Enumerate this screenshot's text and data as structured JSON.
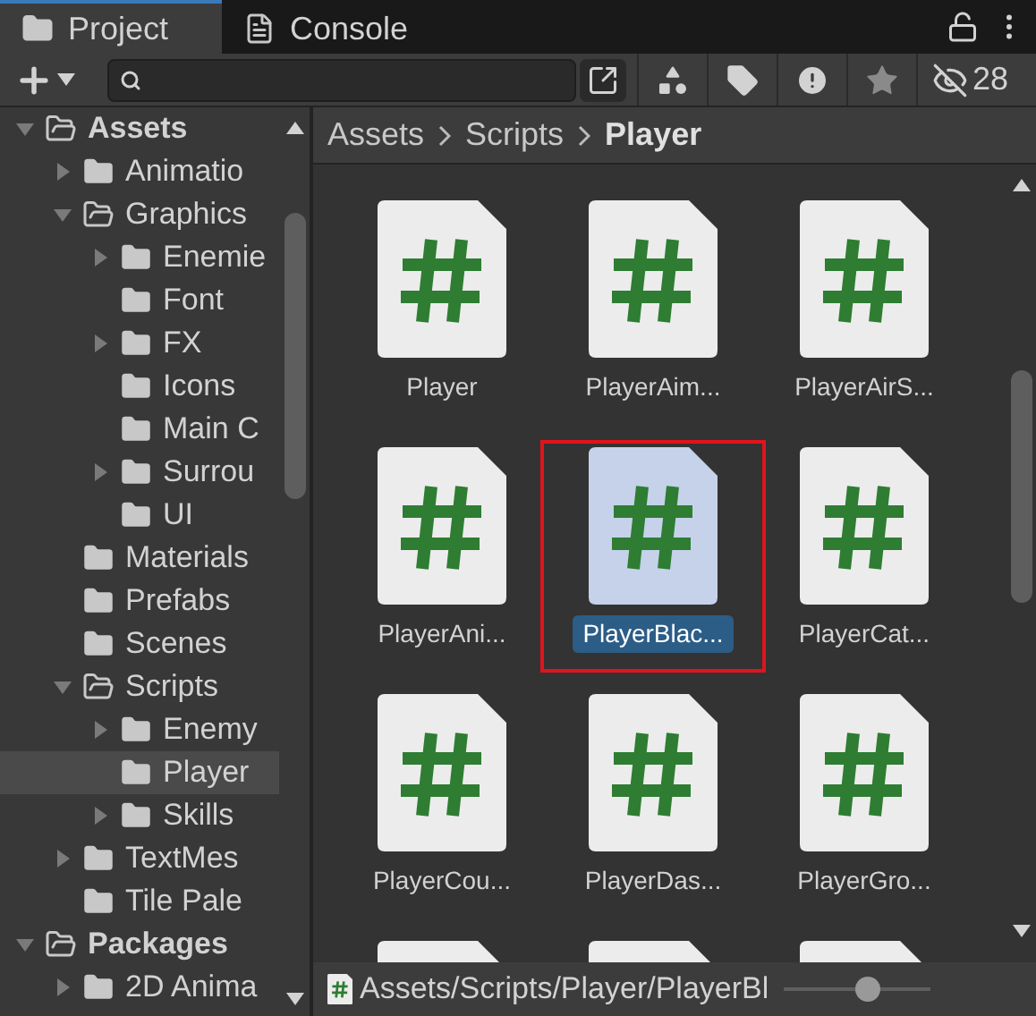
{
  "tabs": [
    {
      "label": "Project",
      "kind": "project",
      "selected": true
    },
    {
      "label": "Console",
      "kind": "console",
      "selected": false
    }
  ],
  "toolbar": {
    "hidden_count": "28"
  },
  "tree": [
    {
      "label": "Assets",
      "kind": "root",
      "expanded": true,
      "selected": false,
      "children": [
        {
          "label": "Animatio",
          "expanded": false,
          "selected": false
        },
        {
          "label": "Graphics",
          "expanded": true,
          "selected": false,
          "children": [
            {
              "label": "Enemie",
              "expanded": false,
              "selected": false
            },
            {
              "label": "Font",
              "selected": false
            },
            {
              "label": "FX",
              "expanded": false,
              "selected": false
            },
            {
              "label": "Icons",
              "selected": false
            },
            {
              "label": "Main C",
              "selected": false
            },
            {
              "label": "Surrou",
              "expanded": false,
              "selected": false
            },
            {
              "label": "UI",
              "selected": false
            }
          ]
        },
        {
          "label": "Materials",
          "selected": false
        },
        {
          "label": "Prefabs",
          "selected": false
        },
        {
          "label": "Scenes",
          "selected": false
        },
        {
          "label": "Scripts",
          "expanded": true,
          "selected": false,
          "children": [
            {
              "label": "Enemy",
              "expanded": false,
              "selected": false
            },
            {
              "label": "Player",
              "selected": true
            },
            {
              "label": "Skills",
              "expanded": false,
              "selected": false
            }
          ]
        },
        {
          "label": "TextMes",
          "expanded": false,
          "selected": false
        },
        {
          "label": "Tile Pale",
          "selected": false
        }
      ]
    },
    {
      "label": "Packages",
      "kind": "root",
      "expanded": true,
      "selected": false,
      "children": [
        {
          "label": "2D Anima",
          "expanded": false,
          "selected": false
        }
      ]
    }
  ],
  "breadcrumb": [
    "Assets",
    "Scripts",
    "Player"
  ],
  "assets": [
    {
      "label": "Player",
      "selected": false,
      "outlined": false
    },
    {
      "label": "PlayerAim...",
      "selected": false,
      "outlined": false
    },
    {
      "label": "PlayerAirS...",
      "selected": false,
      "outlined": false
    },
    {
      "label": "PlayerAni...",
      "selected": false,
      "outlined": false
    },
    {
      "label": "PlayerBlac...",
      "selected": true,
      "outlined": true
    },
    {
      "label": "PlayerCat...",
      "selected": false,
      "outlined": false
    },
    {
      "label": "PlayerCou...",
      "selected": false,
      "outlined": false
    },
    {
      "label": "PlayerDas...",
      "selected": false,
      "outlined": false
    },
    {
      "label": "PlayerGro...",
      "selected": false,
      "outlined": false
    },
    {
      "selected": false,
      "outlined": false
    },
    {
      "selected": false,
      "outlined": false
    },
    {
      "selected": false,
      "outlined": false
    }
  ],
  "status_bar": {
    "path": "Assets/Scripts/Player/PlayerBl",
    "zoom": {
      "level": 0.58
    }
  }
}
